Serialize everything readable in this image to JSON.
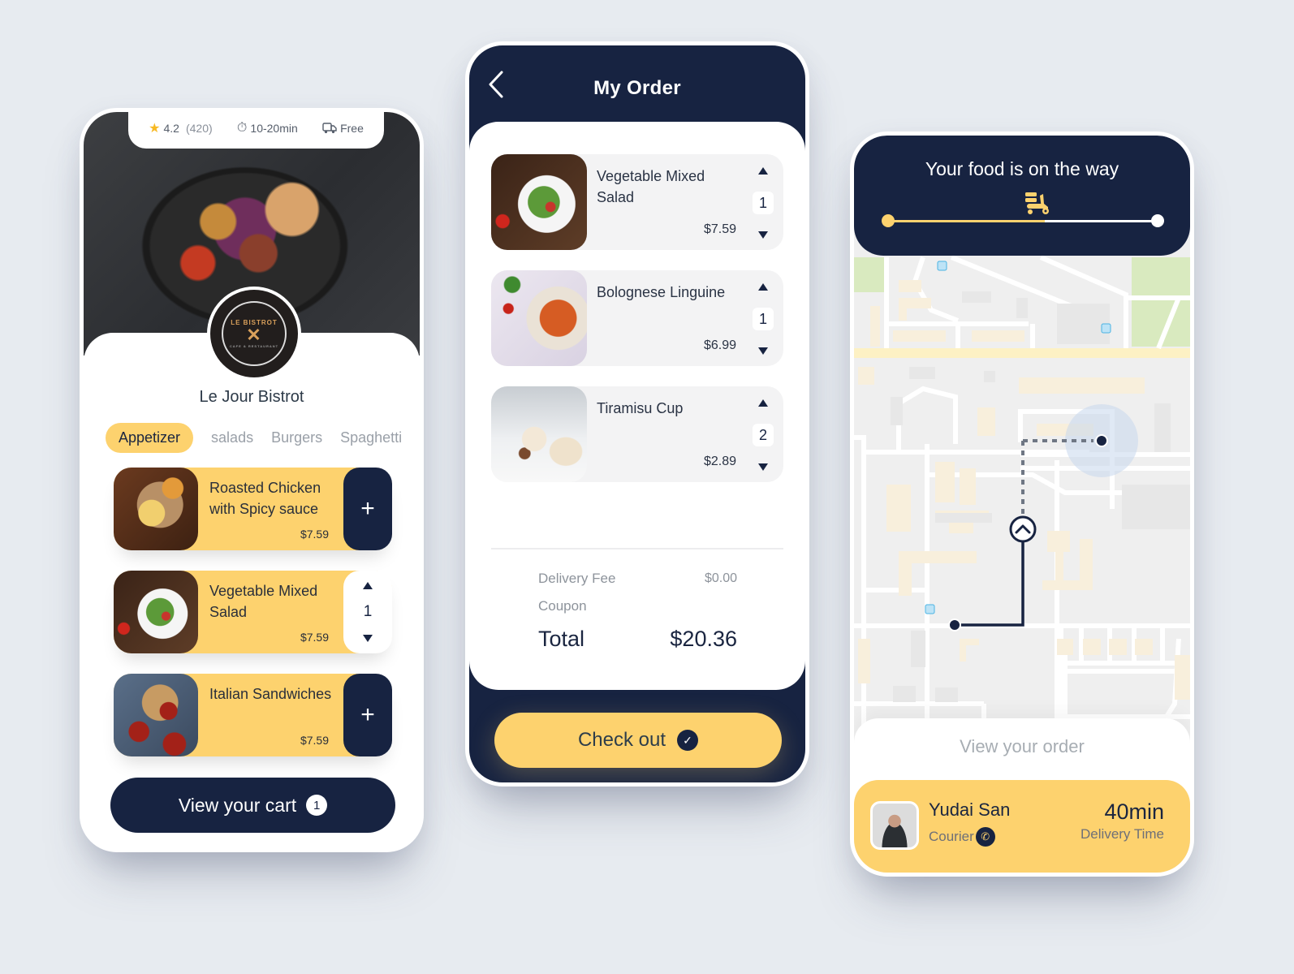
{
  "restaurant_screen": {
    "rating": "4.2",
    "review_count": "(420)",
    "delivery_time": "10-20min",
    "delivery_fee": "Free",
    "logo_text": "LE BISTROT",
    "logo_subtext": "CAFE & RESTAURANT",
    "restaurant_name": "Le Jour Bistrot",
    "categories": [
      {
        "label": "Appetizer",
        "active": true
      },
      {
        "label": "salads",
        "active": false
      },
      {
        "label": "Burgers",
        "active": false
      },
      {
        "label": "Spaghetti",
        "active": false
      }
    ],
    "menu_items": [
      {
        "name": "Roasted Chicken with Spicy sauce",
        "price": "$7.59",
        "control": "add",
        "add_label": "+"
      },
      {
        "name": "Vegetable Mixed Salad",
        "price": "$7.59",
        "control": "qty",
        "quantity": "1"
      },
      {
        "name": "Italian Sandwiches",
        "price": "$7.59",
        "control": "add",
        "add_label": "+"
      }
    ],
    "cart_button": {
      "label": "View your cart",
      "count": "1"
    }
  },
  "order_screen": {
    "title": "My Order",
    "back_icon": "chevron-left",
    "items": [
      {
        "name": "Vegetable Mixed Salad",
        "price": "$7.59",
        "quantity": "1"
      },
      {
        "name": "Bolognese Linguine",
        "price": "$6.99",
        "quantity": "1"
      },
      {
        "name": "Tiramisu Cup",
        "price": "$2.89",
        "quantity": "2"
      }
    ],
    "delivery_fee_label": "Delivery Fee",
    "delivery_fee_value": "$0.00",
    "coupon_label": "Coupon",
    "total_label": "Total",
    "total_value": "$20.36",
    "checkout_label": "Check out"
  },
  "tracking_screen": {
    "title": "Your food is on the way",
    "progress": 0.58,
    "view_order_label": "View your order",
    "courier_name": "Yudai San",
    "courier_role": "Courier",
    "eta_value": "40min",
    "eta_label": "Delivery Time"
  },
  "colors": {
    "navy": "#172341",
    "yellow": "#fdd26e",
    "background": "#e7ebf0"
  }
}
